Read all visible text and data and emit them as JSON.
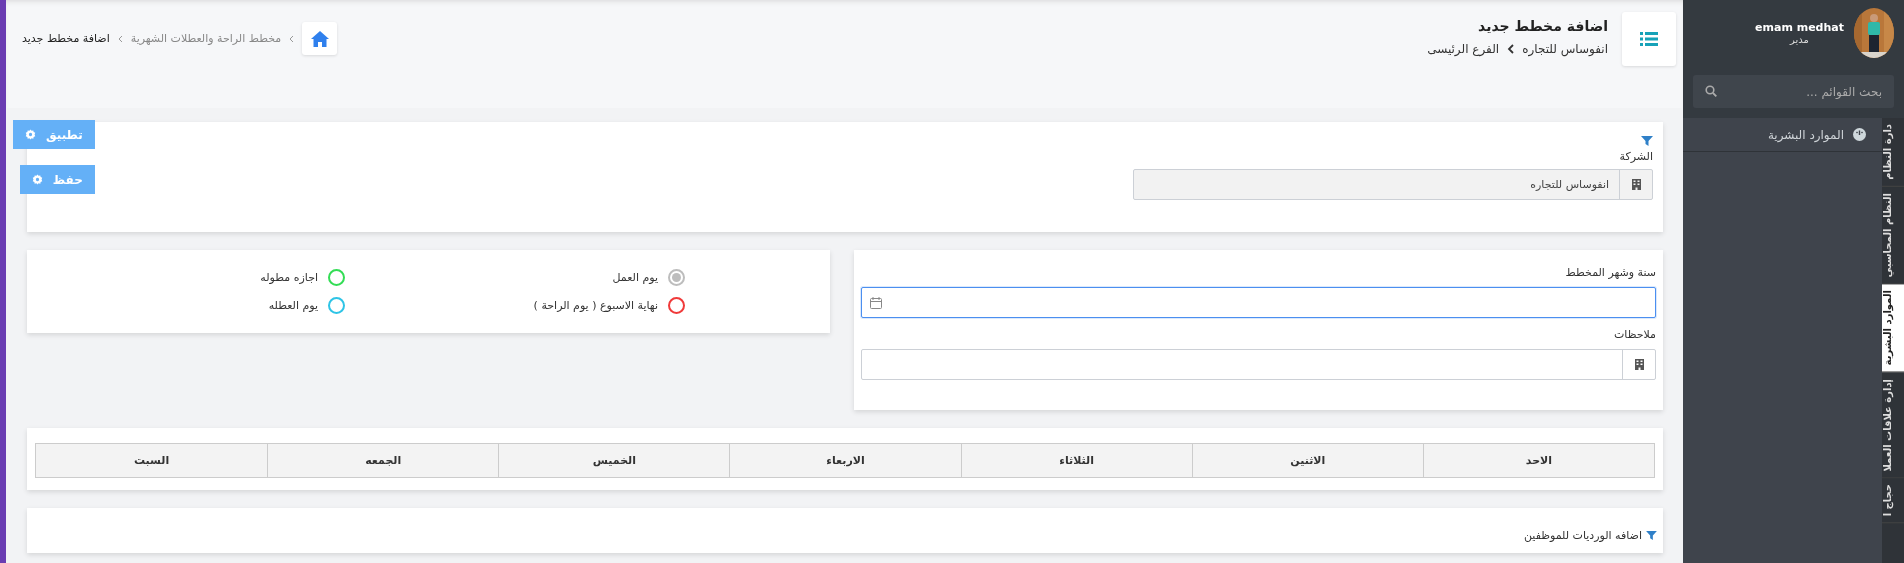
{
  "header": {
    "title": "اضافة مخطط جديد",
    "branch": [
      "انفوساس للتجاره",
      "الفرع الرئيسى"
    ],
    "path": [
      "مخطط الراحة والعطلات الشهرية",
      "اضافة مخطط جديد"
    ]
  },
  "actions": [
    {
      "label": "تطبيق"
    },
    {
      "label": "حفظ"
    }
  ],
  "company": {
    "label": "الشركة",
    "value": "انفوساس للتجاره"
  },
  "plan": {
    "month": {
      "label": "سنة وشهر المخطط",
      "focused": true
    },
    "notes": {
      "label": "ملاحظات"
    }
  },
  "legend": [
    {
      "label": "يوم العمل",
      "color": "#bdbdbd",
      "selected": true
    },
    {
      "label": "اجازه مطوله",
      "color": "#33dd55",
      "selected": false
    },
    {
      "label": "نهاية الاسبوع ( يوم الراحة )",
      "color": "#f03a3a",
      "selected": false
    },
    {
      "label": "يوم العطله",
      "color": "#2ec4e6",
      "selected": false
    }
  ],
  "table": {
    "columns": [
      "الاحد",
      "الاثنين",
      "الثلاثاء",
      "الاربعاء",
      "الخميس",
      "الجمعه",
      "السبت"
    ]
  },
  "shifts": {
    "title": "اضافه الورديات للموظفين"
  },
  "sidebar": {
    "user": {
      "name": "emam medhat",
      "role": "مدير"
    },
    "search": {
      "placeholder": "بحث القوائم ..."
    },
    "items": [
      {
        "label": "الموارد البشرية"
      }
    ],
    "tabs": [
      {
        "label": "دارة النظام",
        "selected": false
      },
      {
        "label": "النظام المحاسبي",
        "selected": false
      },
      {
        "label": "الموارد البشرية",
        "selected": true
      },
      {
        "label": "إدارة علاقات العملا",
        "selected": false
      },
      {
        "label": "حجاج ا",
        "selected": false
      }
    ]
  }
}
